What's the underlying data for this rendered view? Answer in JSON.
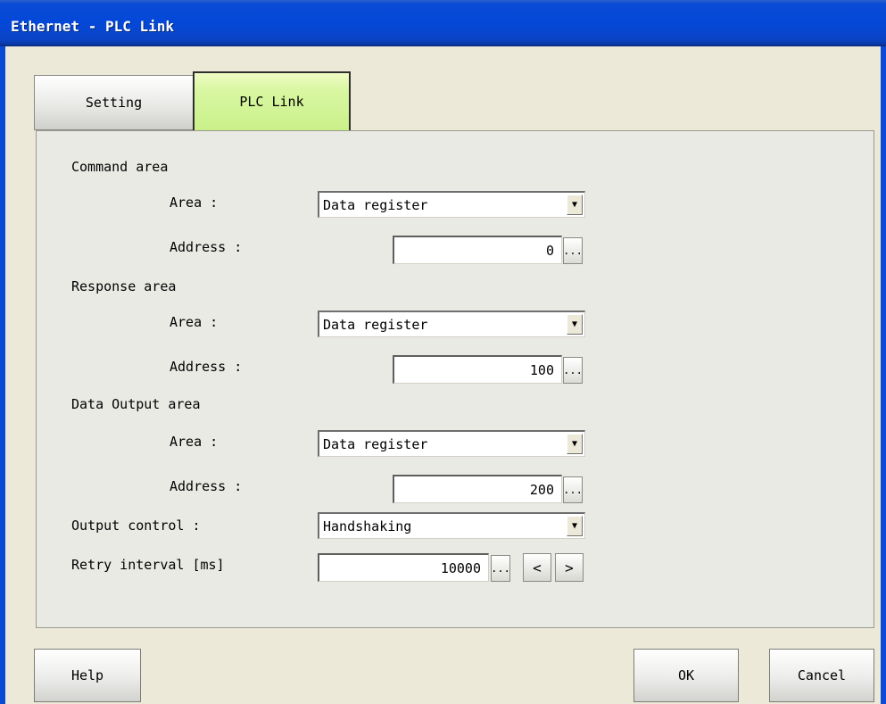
{
  "window": {
    "title": "Ethernet - PLC Link"
  },
  "tabs": [
    {
      "label": "Setting"
    },
    {
      "label": "PLC Link"
    }
  ],
  "command_area": {
    "heading": "Command area",
    "area_label": "Area :",
    "area_value": "Data register",
    "address_label": "Address :",
    "address_value": "0"
  },
  "response_area": {
    "heading": "Response area",
    "area_label": "Area :",
    "area_value": "Data register",
    "address_label": "Address :",
    "address_value": "100"
  },
  "data_output_area": {
    "heading": "Data Output area",
    "area_label": "Area :",
    "area_value": "Data register",
    "address_label": "Address :",
    "address_value": "200"
  },
  "output_control": {
    "label": "Output control :",
    "value": "Handshaking"
  },
  "retry_interval": {
    "label": "Retry interval [ms]",
    "value": "10000"
  },
  "common": {
    "ellipsis": "...",
    "dropdown_arrow": "▼",
    "prev": "<",
    "next": ">"
  },
  "buttons": {
    "help": "Help",
    "ok": "OK",
    "cancel": "Cancel"
  }
}
